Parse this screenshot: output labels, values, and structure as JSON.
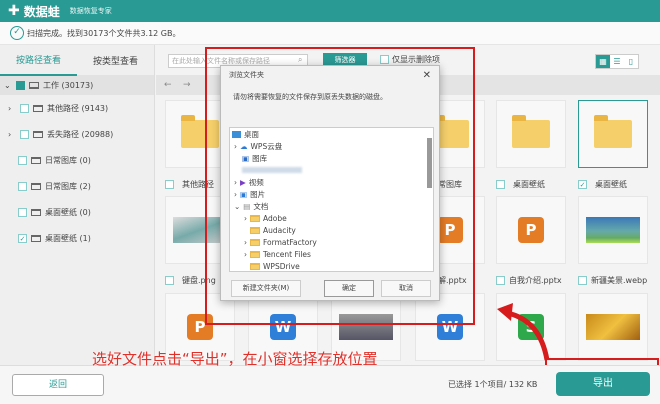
{
  "header": {
    "app_name": "数据蛙",
    "subtitle": "数据恢复专家"
  },
  "status": {
    "text": "扫描完成。找到30173个文件共3.12 GB。"
  },
  "sidebar": {
    "tabs": [
      "按路径查看",
      "按类型查看"
    ],
    "root": {
      "label": "工作 (30173)"
    },
    "items": [
      {
        "label": "其他路径 (9143)",
        "expandable": true,
        "checked": false
      },
      {
        "label": "丢失路径 (20988)",
        "expandable": true,
        "checked": false
      },
      {
        "label": "日常图库 (0)",
        "expandable": false,
        "checked": false
      },
      {
        "label": "日常图库 (2)",
        "expandable": false,
        "checked": false
      },
      {
        "label": "桌面壁纸 (0)",
        "expandable": false,
        "checked": false
      },
      {
        "label": "桌面壁纸 (1)",
        "expandable": false,
        "checked": true
      }
    ]
  },
  "toolbar": {
    "search_placeholder": "在此处输入文件名称或保存路径",
    "filter_label": "筛选器",
    "only_deleted_label": "仅显示删除项",
    "back_arrow": "←",
    "forward_arrow": "→"
  },
  "grid": {
    "row1": [
      {
        "label": "其他路径"
      },
      {
        "label": "日常图库"
      },
      {
        "label": "桌面壁纸",
        "checked": false
      },
      {
        "label": "桌面壁纸",
        "checked": true
      }
    ],
    "row2": [
      {
        "label": "键盘.png"
      },
      {
        "label": "讲解.pptx"
      },
      {
        "label": "自我介绍.pptx"
      },
      {
        "label": "新疆美景.webp"
      }
    ]
  },
  "dialog": {
    "title": "浏览文件夹",
    "message": "请勿将需要恢复的文件保存到原丢失数据的磁盘。",
    "tree": [
      "桌面",
      "WPS云盘",
      "图库",
      "视频",
      "图片",
      "文档",
      "Adobe",
      "Audacity",
      "FormatFactory",
      "Tencent Files",
      "WPSDrive"
    ],
    "new_folder": "新建文件夹(M)",
    "ok": "确定",
    "cancel": "取消"
  },
  "annotation": {
    "caption": "选好文件点击“导出”，在小窗选择存放位置"
  },
  "footer": {
    "back": "返回",
    "selection": "已选择 1个项目/ 132 KB",
    "export": "导出"
  },
  "colors": {
    "accent": "#2a9a94",
    "annotation": "#d61c1c"
  }
}
